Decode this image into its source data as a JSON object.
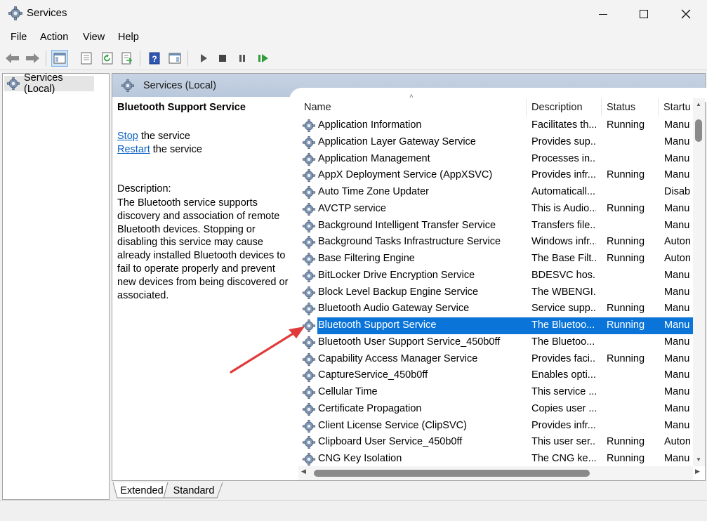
{
  "window": {
    "title": "Services",
    "minimize": "—",
    "maximize": "☐",
    "close": "✕",
    "icon": "gear-icon"
  },
  "menu": [
    "File",
    "Action",
    "View",
    "Help"
  ],
  "toolbar": {
    "icons": [
      "back-arrow-icon",
      "forward-arrow-icon",
      "show-hide-console-tree-icon",
      "properties-icon",
      "refresh-icon",
      "export-list-icon",
      "help-icon",
      "show-hide-action-pane-icon",
      "start-service-icon",
      "stop-service-icon",
      "pause-service-icon",
      "restart-service-icon"
    ]
  },
  "tree": {
    "root_label": "Services (Local)"
  },
  "pane_header": {
    "label": "Services (Local)"
  },
  "detail": {
    "service_name": "Bluetooth Support Service",
    "stop_link": "Stop",
    "stop_rest": " the service",
    "restart_link": "Restart",
    "restart_rest": " the service",
    "description_label": "Description:",
    "description_text": "The Bluetooth service supports discovery and association of remote Bluetooth devices.  Stopping or disabling this service may cause already installed Bluetooth devices to fail to operate properly and prevent new devices from being discovered or associated."
  },
  "list": {
    "columns": [
      "Name",
      "Description",
      "Status",
      "Startu"
    ],
    "sort_caret": "˄",
    "rows": [
      {
        "name": "Application Information",
        "description": "Facilitates th...",
        "status": "Running",
        "startup": "Manu"
      },
      {
        "name": "Application Layer Gateway Service",
        "description": "Provides sup...",
        "status": "",
        "startup": "Manu"
      },
      {
        "name": "Application Management",
        "description": "Processes in...",
        "status": "",
        "startup": "Manu"
      },
      {
        "name": "AppX Deployment Service (AppXSVC)",
        "description": "Provides infr...",
        "status": "Running",
        "startup": "Manu"
      },
      {
        "name": "Auto Time Zone Updater",
        "description": "Automaticall...",
        "status": "",
        "startup": "Disab"
      },
      {
        "name": "AVCTP service",
        "description": "This is Audio...",
        "status": "Running",
        "startup": "Manu"
      },
      {
        "name": "Background Intelligent Transfer Service",
        "description": "Transfers file...",
        "status": "",
        "startup": "Manu"
      },
      {
        "name": "Background Tasks Infrastructure Service",
        "description": "Windows infr...",
        "status": "Running",
        "startup": "Auton"
      },
      {
        "name": "Base Filtering Engine",
        "description": "The Base Filt...",
        "status": "Running",
        "startup": "Auton"
      },
      {
        "name": "BitLocker Drive Encryption Service",
        "description": "BDESVC hos...",
        "status": "",
        "startup": "Manu"
      },
      {
        "name": "Block Level Backup Engine Service",
        "description": "The WBENGI...",
        "status": "",
        "startup": "Manu"
      },
      {
        "name": "Bluetooth Audio Gateway Service",
        "description": "Service supp...",
        "status": "Running",
        "startup": "Manu"
      },
      {
        "name": "Bluetooth Support Service",
        "description": "The Bluetoo...",
        "status": "Running",
        "startup": "Manu",
        "selected": true
      },
      {
        "name": "Bluetooth User Support Service_450b0ff",
        "description": "The Bluetoo...",
        "status": "",
        "startup": "Manu"
      },
      {
        "name": "Capability Access Manager Service",
        "description": "Provides faci...",
        "status": "Running",
        "startup": "Manu"
      },
      {
        "name": "CaptureService_450b0ff",
        "description": "Enables opti...",
        "status": "",
        "startup": "Manu"
      },
      {
        "name": "Cellular Time",
        "description": "This service ...",
        "status": "",
        "startup": "Manu"
      },
      {
        "name": "Certificate Propagation",
        "description": "Copies user ...",
        "status": "",
        "startup": "Manu"
      },
      {
        "name": "Client License Service (ClipSVC)",
        "description": "Provides infr...",
        "status": "",
        "startup": "Manu"
      },
      {
        "name": "Clipboard User Service_450b0ff",
        "description": "This user ser...",
        "status": "Running",
        "startup": "Auton"
      },
      {
        "name": "CNG Key Isolation",
        "description": "The CNG ke...",
        "status": "Running",
        "startup": "Manu"
      }
    ]
  },
  "tabs": [
    "Extended",
    "Standard"
  ],
  "colors": {
    "selection": "#0a74d9",
    "link": "#0b62c4",
    "annotation_arrow": "#e03a3a"
  }
}
